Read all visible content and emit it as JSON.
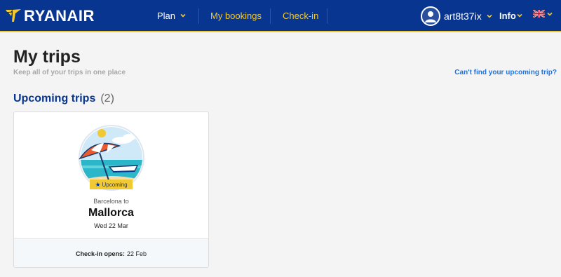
{
  "header": {
    "brand": "RYANAIR",
    "nav": {
      "plan": "Plan",
      "my_bookings": "My bookings",
      "check_in": "Check-in"
    },
    "user": {
      "name": "art8t37ix"
    },
    "info": "Info",
    "language_flag": "uk-flag-icon"
  },
  "page": {
    "title": "My trips",
    "subtitle": "Keep all of your trips in one place",
    "cant_find_link": "Can't find your upcoming trip?"
  },
  "upcoming": {
    "title": "Upcoming trips",
    "count": "(2)",
    "trips": [
      {
        "status": "Upcoming",
        "origin_text": "Barcelona to",
        "destination": "Mallorca",
        "date": "Wed 22 Mar",
        "checkin_label": "Check-in opens:",
        "checkin_date": "22 Feb"
      }
    ]
  },
  "colors": {
    "header_bg": "#073590",
    "accent_yellow": "#f1c933",
    "link_blue": "#1a73e8",
    "section_blue": "#073590"
  }
}
